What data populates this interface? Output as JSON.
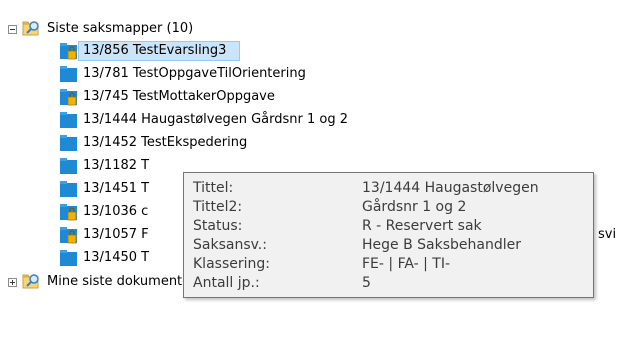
{
  "tree": {
    "root": {
      "label": "Siste saksmapper (10)",
      "icon": "folder-search-icon"
    },
    "items": [
      {
        "label": "13/856 TestEvarsling3",
        "icon": "folder-lock-icon",
        "selected": true
      },
      {
        "label": "13/781 TestOppgaveTilOrientering",
        "icon": "folder-icon"
      },
      {
        "label": "13/745 TestMottakerOppgave",
        "icon": "folder-lock-icon"
      },
      {
        "label": "13/1444 Haugastølvegen Gårdsnr 1 og 2",
        "icon": "folder-icon"
      },
      {
        "label": "13/1452 TestEkspedering",
        "icon": "folder-icon"
      },
      {
        "label": "13/1182 T",
        "icon": "folder-icon"
      },
      {
        "label": "13/1451 T",
        "icon": "folder-icon"
      },
      {
        "label": "13/1036 c",
        "icon": "folder-lock-icon"
      },
      {
        "label": "13/1057 F",
        "icon": "folder-lock-icon",
        "suffix": "svi"
      },
      {
        "label": "13/1450 T",
        "icon": "folder-icon"
      }
    ],
    "next_root": {
      "label": "Mine siste dokumenter (10)",
      "icon": "folder-search-icon"
    }
  },
  "tooltip": {
    "rows": [
      {
        "key": "Tittel:",
        "value": "13/1444 Haugastølvegen"
      },
      {
        "key": "Tittel2:",
        "value": "Gårdsnr 1 og 2"
      },
      {
        "key": "Status:",
        "value": "R - Reservert sak"
      },
      {
        "key": "Saksansv.:",
        "value": "Hege B Saksbehandler"
      },
      {
        "key": "Klassering:",
        "value": "FE- | FA- | TI-"
      },
      {
        "key": "Antall jp.:",
        "value": "5"
      }
    ]
  },
  "colors": {
    "selection_bg": "#cce4f7",
    "selection_border": "#99c9ef",
    "folder_blue": "#1e8ad6",
    "lock_yellow": "#f0b400",
    "tooltip_bg": "#f1f1f1"
  }
}
